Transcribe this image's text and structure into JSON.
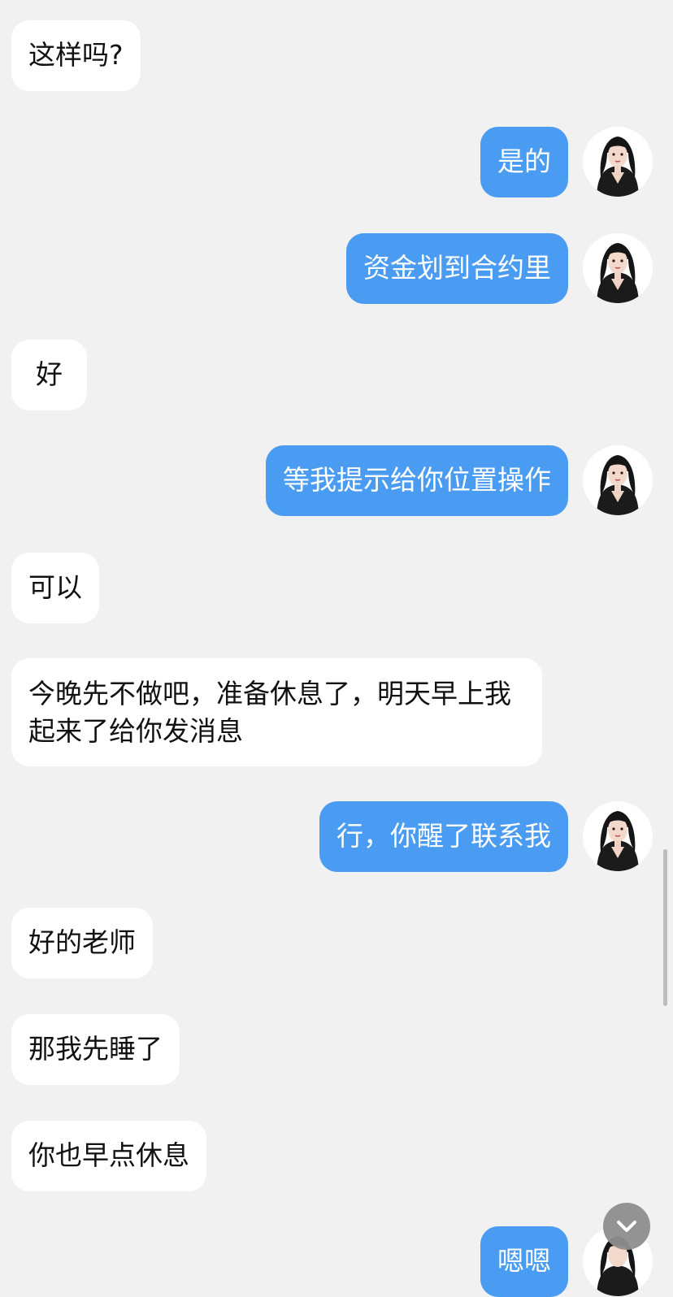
{
  "messages": [
    {
      "side": "incoming",
      "text": "这样吗?"
    },
    {
      "side": "outgoing",
      "text": "是的",
      "avatar_icon": "profile-photo-woman-icon"
    },
    {
      "side": "outgoing",
      "text": "资金划到合约里",
      "avatar_icon": "profile-photo-woman-icon"
    },
    {
      "side": "incoming",
      "text": "好"
    },
    {
      "side": "outgoing",
      "text": "等我提示给你位置操作",
      "avatar_icon": "profile-photo-woman-icon"
    },
    {
      "side": "incoming",
      "text": "可以"
    },
    {
      "side": "incoming",
      "text": "今晚先不做吧，准备休息了，明天早上我起来了给你发消息"
    },
    {
      "side": "outgoing",
      "text": "行，你醒了联系我",
      "avatar_icon": "profile-photo-woman-icon"
    },
    {
      "side": "incoming",
      "text": "好的老师"
    },
    {
      "side": "incoming",
      "text": "那我先睡了"
    },
    {
      "side": "incoming",
      "text": "你也早点休息"
    },
    {
      "side": "outgoing",
      "text": "嗯嗯",
      "avatar_icon": "profile-photo-woman-icon"
    }
  ],
  "colors": {
    "background": "#f1f1f1",
    "incoming_bubble": "#ffffff",
    "outgoing_bubble": "#4a9cf2",
    "outgoing_text": "#ffffff",
    "incoming_text": "#111111"
  },
  "controls": {
    "scroll_down_icon": "chevron-down-icon"
  }
}
